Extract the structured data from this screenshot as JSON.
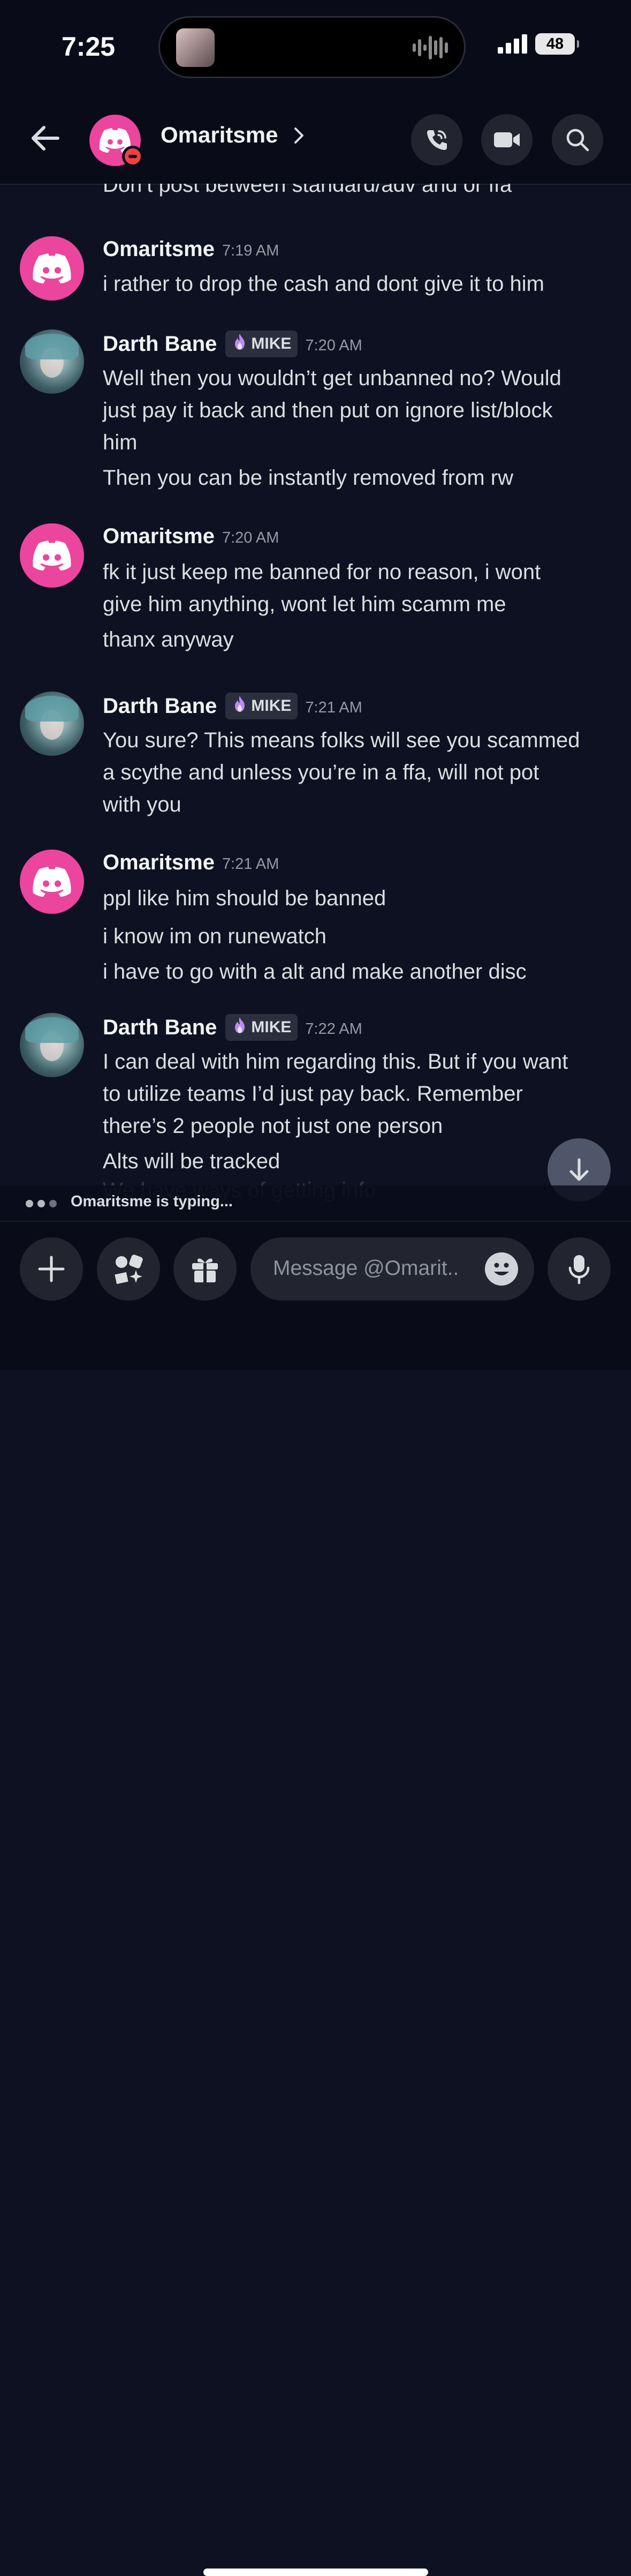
{
  "status_bar": {
    "time": "7:25",
    "battery": "48"
  },
  "header": {
    "title": "Omaritsme"
  },
  "messages": {
    "cut_line": "Don’t post between standard/adv and or ffa",
    "groups": [
      {
        "author": "Omaritsme",
        "time": "7:19 AM",
        "lines": [
          "i rather to drop the cash and dont give it to him"
        ]
      },
      {
        "author": "Darth Bane",
        "tag": "MIKE",
        "time": "7:20 AM",
        "lines": [
          "Well then you wouldn’t get unbanned no? Would",
          "just pay it back and then put on ignore list/block",
          "him",
          "Then you can be instantly removed from rw"
        ]
      },
      {
        "author": "Omaritsme",
        "time": "7:20 AM",
        "lines": [
          "fk it just keep me banned for no reason, i wont",
          "give him anything, wont let him scamm me",
          "thanx anyway"
        ]
      },
      {
        "author": "Darth Bane",
        "tag": "MIKE",
        "time": "7:21 AM",
        "lines": [
          "You sure? This means folks will see you scammed",
          "a scythe and unless you’re in a ffa, will not pot",
          "with you"
        ]
      },
      {
        "author": "Omaritsme",
        "time": "7:21 AM",
        "lines": [
          "ppl like him should be banned",
          "i know im on runewatch",
          "i have to go with a alt and make another disc"
        ]
      },
      {
        "author": "Darth Bane",
        "tag": "MIKE",
        "time": "7:22 AM",
        "lines": [
          "I can deal with him regarding this. But if you want",
          "to utilize teams I’d just pay back. Remember",
          "there’s 2 people not just one person",
          "Alts will be tracked",
          "We have ways of getting info"
        ]
      }
    ]
  },
  "typing": {
    "text": "Omaritsme is typing..."
  },
  "composer": {
    "placeholder": "Message @Omarit.."
  },
  "icons": [
    "back-arrow-icon",
    "discord-logo-icon",
    "dnd-status-icon",
    "chevron-right-icon",
    "phone-icon",
    "video-camera-icon",
    "search-icon",
    "arrow-down-icon",
    "plus-icon",
    "apps-icon",
    "gift-icon",
    "emoji-icon",
    "microphone-icon"
  ]
}
